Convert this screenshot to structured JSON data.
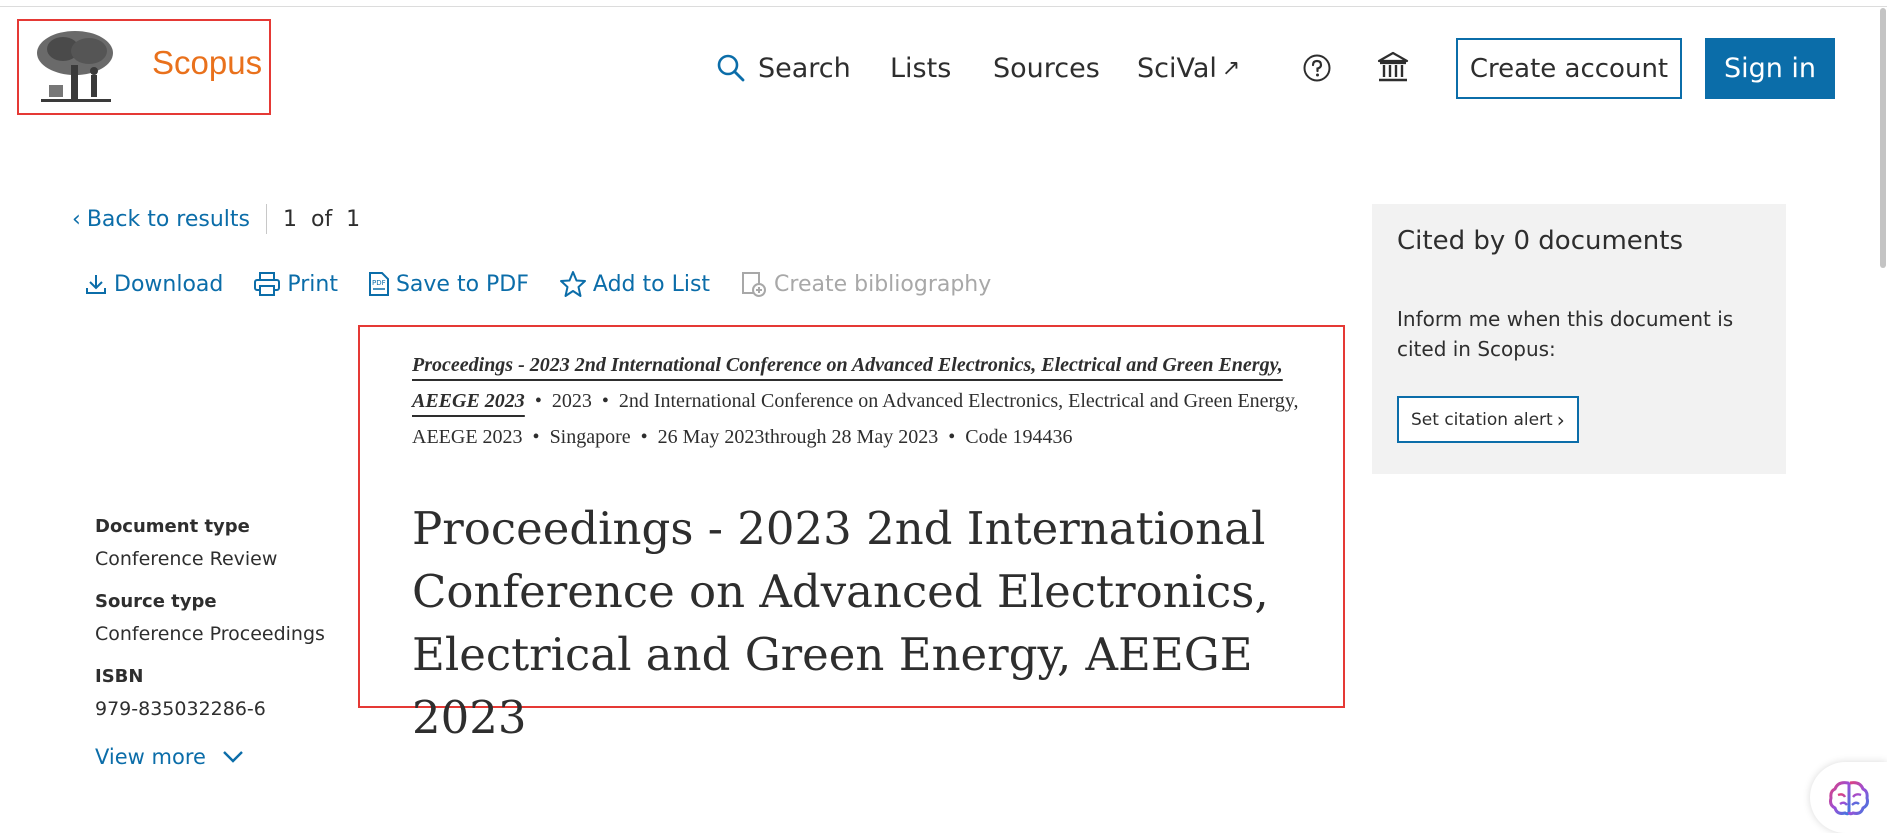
{
  "header": {
    "logo_text": "Scopus",
    "nav": {
      "search": "Search",
      "lists": "Lists",
      "sources": "Sources",
      "scival": "SciVal",
      "scival_arrow": "↗"
    },
    "create_account": "Create account",
    "sign_in": "Sign in"
  },
  "back": {
    "label": "Back to results",
    "chevron": "‹",
    "pager": "1  of  1"
  },
  "actions": {
    "download": "Download",
    "print": "Print",
    "save_pdf": "Save to PDF",
    "add_list": "Add to List",
    "create_bib": "Create bibliography"
  },
  "source": {
    "title": "Proceedings - 2023 2nd International Conference on Advanced Electronics, Electrical and Green Energy, AEEGE 2023",
    "year": "2023",
    "conference": "2nd International Conference on Advanced Electronics, Electrical and Green Energy, AEEGE 2023",
    "location": "Singapore",
    "dates": "26 May 2023through 28 May 2023",
    "code": "Code 194436"
  },
  "document": {
    "title": "Proceedings - 2023 2nd International Conference on Advanced Electronics, Electrical and Green Energy, AEEGE 2023"
  },
  "meta": {
    "doc_type_label": "Document type",
    "doc_type_value": "Conference Review",
    "source_type_label": "Source type",
    "source_type_value": "Conference Proceedings",
    "isbn_label": "ISBN",
    "isbn_value": "979-835032286-6",
    "view_more": "View more"
  },
  "cited": {
    "title": "Cited by 0 documents",
    "text": "Inform me when this document is cited in Scopus:",
    "button": "Set citation alert",
    "button_chevron": "›"
  },
  "colors": {
    "brand_orange": "#e9711c",
    "link_blue": "#0b6da9",
    "highlight_red": "#e53935"
  },
  "icons": [
    "tree-logo-icon",
    "search-icon",
    "help-icon",
    "institution-icon",
    "download-icon",
    "print-icon",
    "pdf-icon",
    "star-icon",
    "bibliography-icon",
    "chevron-down-icon",
    "assistant-brain-icon"
  ]
}
